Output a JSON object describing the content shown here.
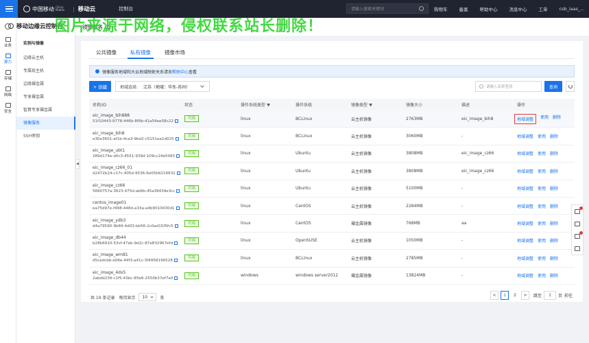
{
  "topbar": {
    "brand_mobile": "中国移动",
    "brand_mobile_sub": "China Mobile",
    "brand_cloud": "移动云",
    "console": "控制台",
    "search_placeholder": "请输入搜索关键词",
    "links": [
      "购物车",
      "备案",
      "帮助中心",
      "消息中心"
    ],
    "ticket": "工单",
    "user": "csb_iaas_..."
  },
  "watermark": "图片来源于网络，侵权联系站长删除！",
  "leftnav": {
    "items": [
      {
        "label": "业务",
        "icon": "business-icon"
      },
      {
        "label": "算力",
        "icon": "compute-icon",
        "active": true
      },
      {
        "label": "存储",
        "icon": "storage-icon"
      },
      {
        "label": "网络",
        "icon": "network-icon"
      },
      {
        "label": "安全",
        "icon": "security-icon"
      }
    ]
  },
  "sidebar": {
    "title": "移动边缘云控制台",
    "group": "实例与镜像",
    "items": [
      "边缘云主机",
      "专属现主机",
      "边缘裸金属",
      "专享裸金属",
      "智算专享裸金属",
      "镜像服务",
      "SSH密钥"
    ],
    "active_index": 5
  },
  "page": {
    "title": "镜像服务",
    "help": "?"
  },
  "tabs": [
    "公共镜像",
    "私有镜像",
    "镜像市场"
  ],
  "active_tab": 1,
  "notice": {
    "text": "镜像服务地域和大云地域映射关系请去",
    "link": "帮助中心",
    "suffix": "查看"
  },
  "toolbar": {
    "create": "+ 创建",
    "region_label": "地域选择:",
    "region_value": "江苏（地域：华东-苏州）",
    "search_placeholder": "请输入名称查找",
    "search_btn": "查询"
  },
  "table": {
    "headers": [
      "名称/ID",
      "状态",
      "操作系统类型",
      "操作系统",
      "镜像类型",
      "镜像大小",
      "描述",
      "操作"
    ],
    "actions": [
      "地域调整",
      "使用",
      "删除"
    ],
    "rows": [
      {
        "name": "eic_image_bih888",
        "id": "51f10443-9778-446b-8f9b-41a54ee58c22",
        "status": "可用",
        "os_type": "linux",
        "os": "BCLinux",
        "img_type": "云主机镜像",
        "size": "2763MB",
        "desc": "eic_image_bih8"
      },
      {
        "name": "eic_image_bih8",
        "id": "e30a3601-af1b-4ca3-9bd2-c5151ea1d025",
        "status": "可用",
        "os_type": "linux",
        "os": "BCLinux",
        "img_type": "云主机镜像",
        "size": "3060MB",
        "desc": "-"
      },
      {
        "name": "eic_image_ubt1",
        "id": "289d174e-d0c3-4551-939d-109cc24e5065",
        "status": "可用",
        "os_type": "linux",
        "os": "Ubuntu",
        "img_type": "云主机镜像",
        "size": "3808MB",
        "desc": "eic_image_cz66"
      },
      {
        "name": "eic_image_cz66_01",
        "id": "d2472b24-c17c-405d-9536-6e05b9216632",
        "status": "可用",
        "os_type": "linux",
        "os": "Ubuntu",
        "img_type": "云主机镜像",
        "size": "3808MB",
        "desc": "eic_image_cz66"
      },
      {
        "name": "eic_image_cz66",
        "id": "5660757a-3623-475d-ab6b-45a38434e3cc",
        "status": "可用",
        "os_type": "linux",
        "os": "Ubuntu",
        "img_type": "云主机镜像",
        "size": "5100MB",
        "desc": "-"
      },
      {
        "name": "centos_image01",
        "id": "ea75d97e-f498-448d-a33a-a4b9010430d1",
        "status": "可用",
        "os_type": "linux",
        "os": "CentOS",
        "img_type": "云主机镜像",
        "size": "2284MB",
        "desc": "-"
      },
      {
        "name": "eic_image_ydb3",
        "id": "d4a79590-9b84-4d03-bb56-2c0ad15f5fc5",
        "status": "可用",
        "os_type": "linux",
        "os": "CentOS",
        "img_type": "裸金属镜像",
        "size": "768MB",
        "desc": "aa"
      },
      {
        "name": "eic_image_db44",
        "id": "b28b6910-53cf-47eb-9d2c-87e832967efd",
        "status": "可用",
        "os_type": "linux",
        "os": "OpenSUSE",
        "img_type": "云主机镜像",
        "size": "1050MB",
        "desc": "-"
      },
      {
        "name": "eic_image_wm81",
        "id": "d5cadcbb-e06e-44f3-a41c-3f4958196528",
        "status": "可用",
        "os_type": "linux",
        "os": "BCLinux",
        "img_type": "云主机镜像",
        "size": "2785MB",
        "desc": "-"
      },
      {
        "name": "eic_image_4dx5",
        "id": "2abdd239-c1f5-43bc-85b6-2550b37ef7e0",
        "status": "可用",
        "os_type": "windows",
        "os": "windows server2012",
        "img_type": "裸金属镜像",
        "size": "13824MB",
        "desc": "-"
      }
    ]
  },
  "pager": {
    "total": "共 19 条记录",
    "per_page_label": "每页显示",
    "per_page": "10",
    "per_page_unit": "条",
    "prev": "<",
    "pages": [
      "1",
      "2"
    ],
    "next": ">",
    "jump_label": "跳至",
    "jump_value": "1",
    "jump_unit": "页",
    "go": "前往"
  }
}
